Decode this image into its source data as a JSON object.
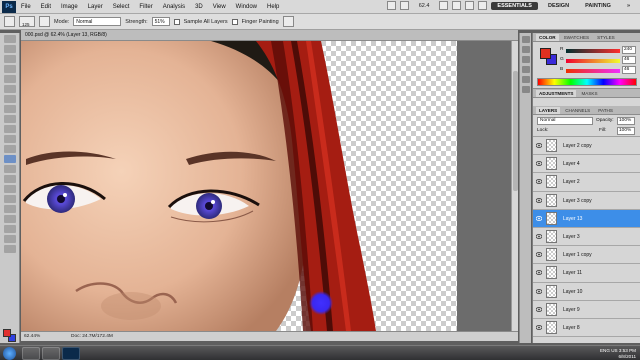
{
  "app": {
    "logo": "Ps",
    "menu": [
      "File",
      "Edit",
      "Image",
      "Layer",
      "Select",
      "Filter",
      "Analysis",
      "3D",
      "View",
      "Window",
      "Help"
    ],
    "zoom_display": "62.4",
    "workspaces": [
      "ESSENTIALS",
      "DESIGN",
      "PAINTING"
    ]
  },
  "options": {
    "brush_size": "125",
    "mode_label": "Mode:",
    "mode_value": "Normal",
    "strength_label": "Strength:",
    "strength_value": "51%",
    "sample_all_layers": "Sample All Layers",
    "finger_painting": "Finger Painting"
  },
  "document": {
    "tab_title": "000.psd @ 62.4% (Layer 13, RGB/8)",
    "zoom": "62.44%",
    "doc_size": "Doc: 24.7M/172.4M"
  },
  "color_panel": {
    "tabs": [
      "COLOR",
      "SWATCHES",
      "STYLES"
    ],
    "r_label": "R",
    "r_value": "240",
    "g_label": "G",
    "g_value": "46",
    "b_label": "B",
    "b_value": "46",
    "fg_color": "#f02e2e",
    "bg_color": "#3a2ad8"
  },
  "adjustments": {
    "tabs": [
      "ADJUSTMENTS",
      "MASKS"
    ]
  },
  "layers_panel": {
    "tabs": [
      "LAYERS",
      "CHANNELS",
      "PATHS"
    ],
    "blend_mode": "Normal",
    "opacity_label": "Opacity:",
    "opacity_value": "100%",
    "lock_label": "Lock:",
    "fill_label": "Fill:",
    "fill_value": "100%",
    "layers": [
      {
        "name": "Layer 2 copy",
        "selected": false
      },
      {
        "name": "Layer 4",
        "selected": false
      },
      {
        "name": "Layer 2",
        "selected": false
      },
      {
        "name": "Layer 3 copy",
        "selected": false
      },
      {
        "name": "Layer 13",
        "selected": true
      },
      {
        "name": "Layer 3",
        "selected": false
      },
      {
        "name": "Layer 1 copy",
        "selected": false
      },
      {
        "name": "Layer 11",
        "selected": false
      },
      {
        "name": "Layer 10",
        "selected": false
      },
      {
        "name": "Layer 9",
        "selected": false
      },
      {
        "name": "Layer 8",
        "selected": false
      }
    ]
  },
  "taskbar": {
    "time": "3:53 PM",
    "date": "6/8/2011",
    "language": "ENG US"
  }
}
